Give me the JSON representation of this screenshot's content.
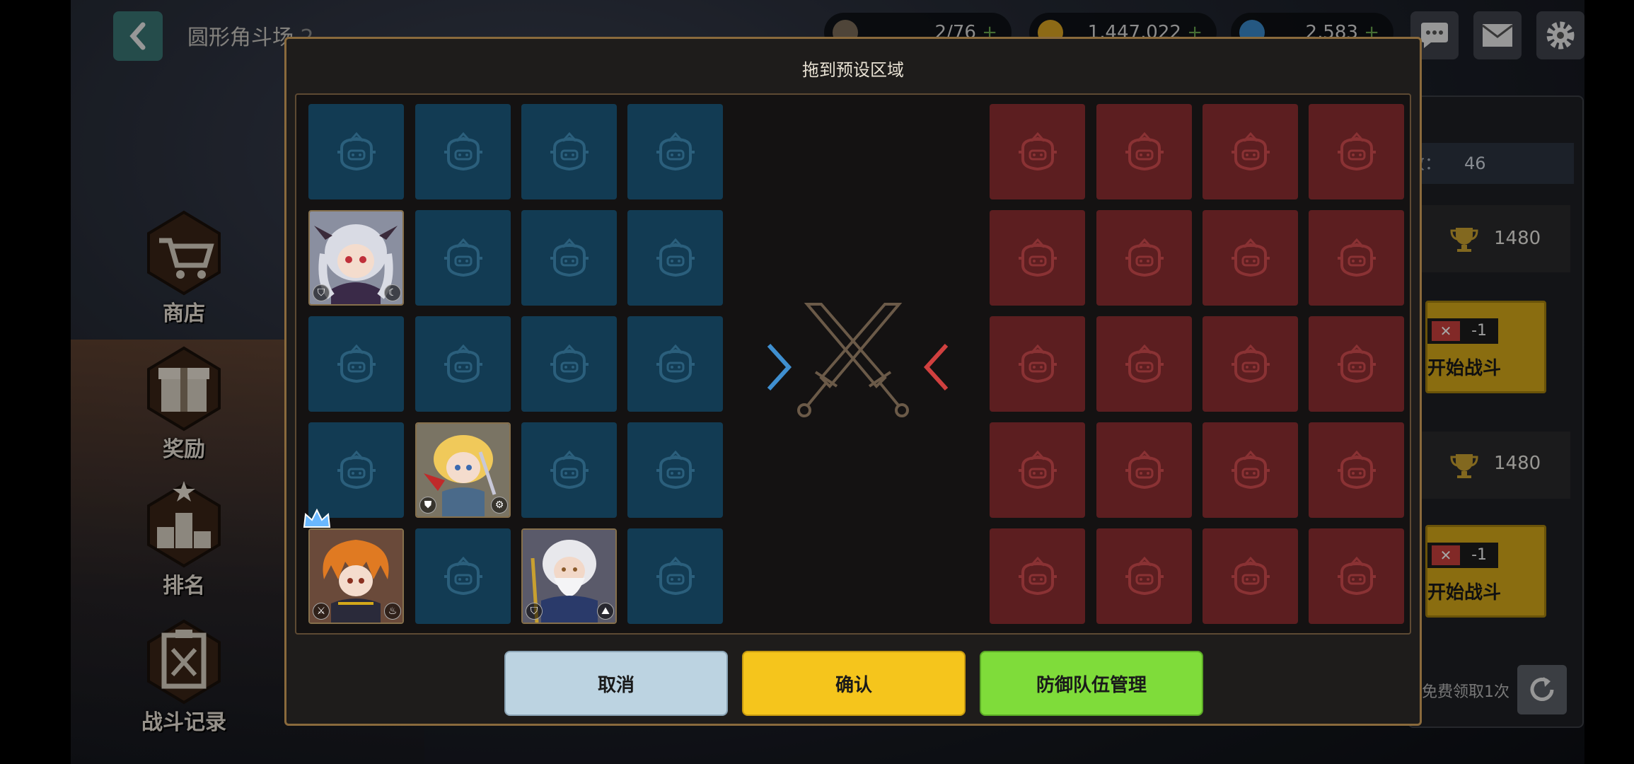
{
  "header": {
    "title": "圆形角斗场",
    "level": "2",
    "resources": [
      {
        "icon": "stamina-cup-icon",
        "value": "2/76"
      },
      {
        "icon": "gold-coin-icon",
        "value": "1,447,022"
      },
      {
        "icon": "blue-gem-icon",
        "value": "2,583"
      }
    ]
  },
  "left_menu": [
    {
      "label": "商店",
      "icon": "cart-icon"
    },
    {
      "label": "奖励",
      "icon": "gift-icon"
    },
    {
      "label": "排名",
      "icon": "podium-icon"
    },
    {
      "label": "战斗记录",
      "icon": "battle-log-icon"
    }
  ],
  "right_panel": {
    "count_label": "敌：",
    "count_value": "46",
    "opponents": [
      {
        "trophies": "1480",
        "ticket_cost": "-1",
        "button": "开始战斗"
      },
      {
        "trophies": "1480",
        "ticket_cost": "-1",
        "button": "开始战斗"
      }
    ],
    "free_text": "免费领取1次"
  },
  "dialog": {
    "title": "拖到预设区域",
    "buttons": {
      "cancel": "取消",
      "confirm": "确认",
      "defense": "防御队伍管理"
    },
    "ally_heroes": [
      {
        "name": "silver-haired-horned-girl",
        "row": 1,
        "col": 0,
        "badges": [
          "shield-badge",
          "moon-badge"
        ]
      },
      {
        "name": "blonde-swordswoman",
        "row": 3,
        "col": 1,
        "badges": [
          "guard-badge",
          "gear-badge"
        ]
      },
      {
        "name": "orange-haired-leader",
        "row": 4,
        "col": 0,
        "badges": [
          "sword-badge",
          "fire-badge"
        ],
        "crown": true
      },
      {
        "name": "white-bearded-sage",
        "row": 4,
        "col": 2,
        "badges": [
          "shield-badge",
          "mountain-badge"
        ]
      }
    ]
  },
  "colors": {
    "ally_cell": "#123b53",
    "enemy_cell": "#5c1e20",
    "cancel": "#bcd3e1",
    "confirm": "#f5c51c",
    "defense": "#7fdc3a"
  }
}
